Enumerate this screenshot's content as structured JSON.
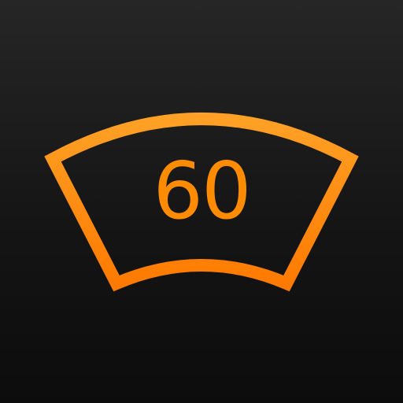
{
  "icon": {
    "speed_value": "60",
    "symbol": "windshield-frame-icon"
  },
  "colors": {
    "background_top": "#262626",
    "background_bottom": "#0c0c0c",
    "accent_light": "#ffa126",
    "accent_dark": "#ff7a00",
    "speed_text": "#ff8c00"
  }
}
